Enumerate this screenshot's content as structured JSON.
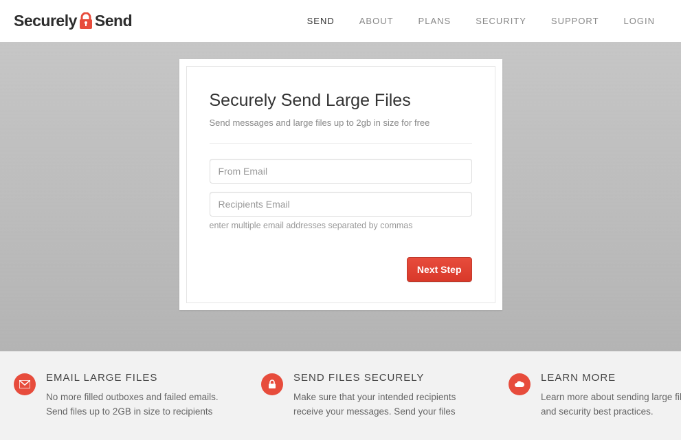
{
  "logo": {
    "part1": "Securely",
    "part2": "Send"
  },
  "nav": {
    "send": "SEND",
    "about": "ABOUT",
    "plans": "PLANS",
    "security": "SECURITY",
    "support": "SUPPORT",
    "login": "LOGIN"
  },
  "form": {
    "title": "Securely Send Large Files",
    "subtitle": "Send messages and large files up to 2gb in size for free",
    "from_placeholder": "From Email",
    "recipients_placeholder": "Recipients Email",
    "hint": "enter multiple email addresses separated by commas",
    "button": "Next Step"
  },
  "features": {
    "f1": {
      "title": "EMAIL LARGE FILES",
      "body": "No more filled outboxes and failed emails. Send files up to 2GB in size to recipients"
    },
    "f2": {
      "title": "SEND FILES SECURELY",
      "body": "Make sure that your intended recipients receive your messages. Send your files"
    },
    "f3": {
      "title": "LEARN MORE",
      "body": "Learn more about sending large files by email and security best practices."
    }
  }
}
